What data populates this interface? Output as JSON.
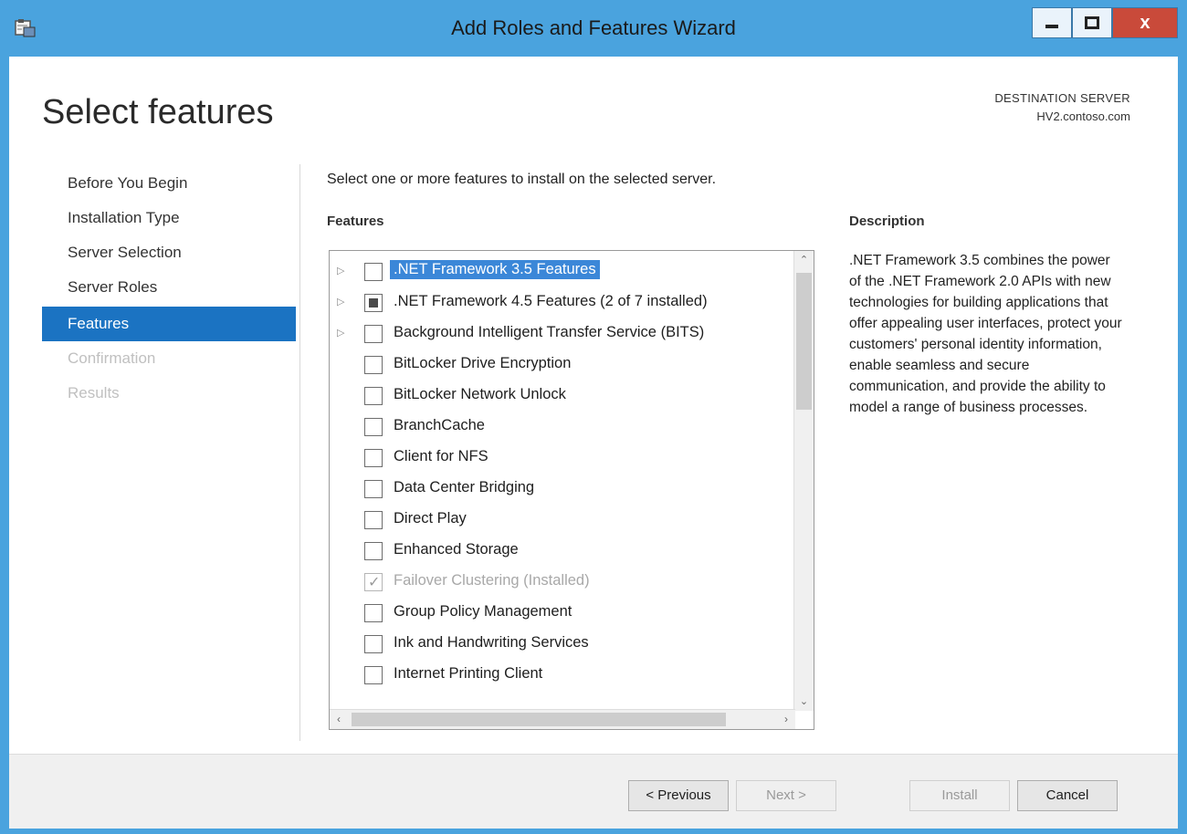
{
  "window": {
    "title": "Add Roles and Features Wizard",
    "close_glyph": "x"
  },
  "page": {
    "title": "Select features",
    "destination_label": "DESTINATION SERVER",
    "destination_server": "HV2.contoso.com",
    "intro": "Select one or more features to install on the selected server.",
    "features_header": "Features",
    "description_header": "Description",
    "description": ".NET Framework 3.5 combines the power of the .NET Framework 2.0 APIs with new technologies for building applications that offer appealing user interfaces, protect your customers' personal identity information, enable seamless and secure communication, and provide the ability to model a range of business processes."
  },
  "nav": {
    "items": [
      {
        "label": "Before You Begin",
        "state": "normal"
      },
      {
        "label": "Installation Type",
        "state": "normal"
      },
      {
        "label": "Server Selection",
        "state": "normal"
      },
      {
        "label": "Server Roles",
        "state": "normal"
      },
      {
        "label": "Features",
        "state": "active"
      },
      {
        "label": "Confirmation",
        "state": "disabled"
      },
      {
        "label": "Results",
        "state": "disabled"
      }
    ]
  },
  "features": [
    {
      "label": ".NET Framework 3.5 Features",
      "expandable": true,
      "check": "unchecked",
      "selected": true
    },
    {
      "label": ".NET Framework 4.5 Features (2 of 7 installed)",
      "expandable": true,
      "check": "partial"
    },
    {
      "label": "Background Intelligent Transfer Service (BITS)",
      "expandable": true,
      "check": "unchecked"
    },
    {
      "label": "BitLocker Drive Encryption",
      "expandable": false,
      "check": "unchecked"
    },
    {
      "label": "BitLocker Network Unlock",
      "expandable": false,
      "check": "unchecked"
    },
    {
      "label": "BranchCache",
      "expandable": false,
      "check": "unchecked"
    },
    {
      "label": "Client for NFS",
      "expandable": false,
      "check": "unchecked"
    },
    {
      "label": "Data Center Bridging",
      "expandable": false,
      "check": "unchecked"
    },
    {
      "label": "Direct Play",
      "expandable": false,
      "check": "unchecked"
    },
    {
      "label": "Enhanced Storage",
      "expandable": false,
      "check": "unchecked"
    },
    {
      "label": "Failover Clustering (Installed)",
      "expandable": false,
      "check": "installed"
    },
    {
      "label": "Group Policy Management",
      "expandable": false,
      "check": "unchecked"
    },
    {
      "label": "Ink and Handwriting Services",
      "expandable": false,
      "check": "unchecked"
    },
    {
      "label": "Internet Printing Client",
      "expandable": false,
      "check": "unchecked"
    }
  ],
  "scrollbar": {
    "h_thumb_label": "III"
  },
  "footer": {
    "previous": "< Previous",
    "next": "Next >",
    "install": "Install",
    "cancel": "Cancel"
  },
  "colors": {
    "frame": "#4aa3de",
    "nav_active": "#1b73c2",
    "selection": "#3b87d8",
    "close_button": "#c94a3a"
  }
}
